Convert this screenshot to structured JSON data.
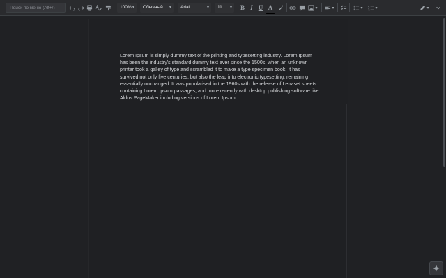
{
  "toolbar": {
    "search_placeholder": "Поиск по меню (Alt+/)",
    "zoom": "100%",
    "style": "Обычный ...",
    "font": "Arial",
    "font_size": "11",
    "bold": "B",
    "italic": "I",
    "underline": "U",
    "text_color": "A",
    "more": "···"
  },
  "document": {
    "paragraph": "Lorem Ipsum is simply dummy text of the printing and typesetting industry. Lorem Ipsum has been the industry's standard dummy text ever since the 1500s, when an unknown printer took a galley of type and scrambled it to make a type specimen book. It has survived not only five centuries, but also the leap into electronic typesetting, remaining essentially unchanged. It was popularised in the 1960s with the release of Letraset sheets containing Lorem Ipsum passages, and more recently with desktop publishing software like Aldus PageMaker including versions of Lorem Ipsum."
  },
  "icons": [
    "undo-icon",
    "redo-icon",
    "print-icon",
    "spellcheck-icon",
    "paint-format-icon",
    "link-icon",
    "comment-icon",
    "image-icon",
    "align-left-icon",
    "checklist-icon",
    "bulleted-list-icon",
    "numbered-list-icon",
    "pen-icon",
    "chevron-up-icon",
    "explore-icon"
  ],
  "colors": {
    "background": "#202124",
    "toolbar": "#2a2b2e",
    "text": "#d6d8db"
  }
}
